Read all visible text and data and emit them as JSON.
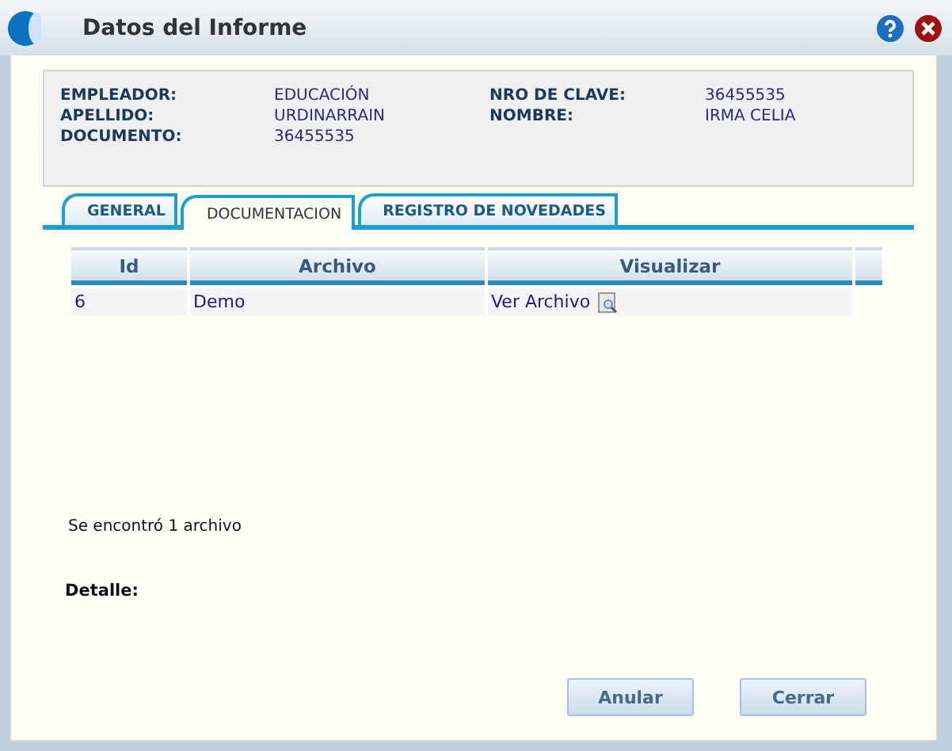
{
  "window": {
    "title": "Datos del Informe"
  },
  "info": [
    {
      "label": "EMPLEADOR:",
      "value": "EDUCACIÓN"
    },
    {
      "label": "NRO DE CLAVE:",
      "value": "36455535"
    },
    {
      "label": "APELLIDO:",
      "value": "URDINARRAIN"
    },
    {
      "label": "NOMBRE:",
      "value": "IRMA CELIA"
    },
    {
      "label": "DOCUMENTO:",
      "value": "36455535"
    }
  ],
  "tabs": [
    {
      "label": "GENERAL",
      "selected": false
    },
    {
      "label": "DOCUMENTACION",
      "selected": true
    },
    {
      "label": "REGISTRO DE NOVEDADES",
      "selected": false
    }
  ],
  "table": {
    "columns": [
      "Id",
      "Archivo",
      "Visualizar"
    ],
    "rows": [
      {
        "id": "6",
        "archivo": "Demo",
        "visualizar": "Ver Archivo"
      }
    ]
  },
  "status": "Se encontró 1 archivo",
  "detail_label": "Detalle:",
  "buttons": [
    "Anular",
    "Cerrar"
  ]
}
